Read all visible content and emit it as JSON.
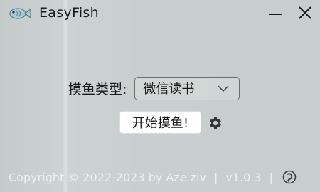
{
  "window": {
    "title": "EasyFish",
    "app_icon": "fish-icon",
    "minimize_icon": "minimize-icon",
    "close_icon": "close-icon"
  },
  "main": {
    "type_label": "摸鱼类型:",
    "type_select": {
      "value": "微信读书",
      "icon": "chevron-down-icon"
    },
    "start_button": "开始摸鱼!",
    "settings_icon": "gear-icon"
  },
  "footer": {
    "copyright": "Copyright © 2022-2023 by Aze.ziv",
    "separator": "|",
    "version": "v1.0.3",
    "footer_icon": "fish-hook-icon"
  },
  "colors": {
    "background": "#c9d0cf",
    "text": "#1a1a1a",
    "footer_text": "#eef2f2",
    "button_bg": "#ffffff"
  }
}
